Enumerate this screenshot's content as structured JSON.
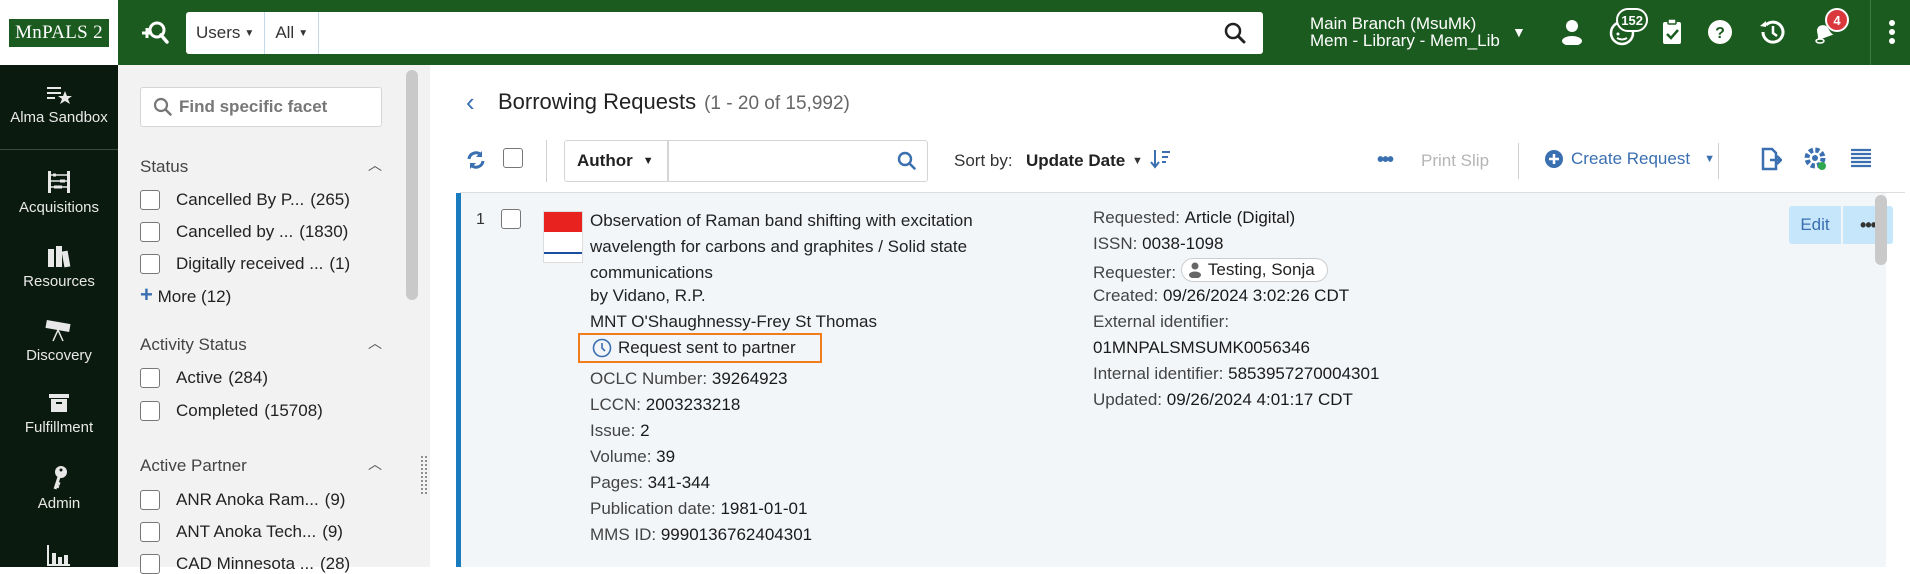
{
  "topbar": {
    "logo": "MnPALS 2",
    "search_scope": "Users",
    "search_field": "All",
    "search_value": "",
    "branch_line1": "Main Branch (MsuMk)",
    "branch_line2": "Mem - Library - Mem_Lib",
    "tasks_badge": "152",
    "notifications_badge": "4",
    "icons": [
      "advanced-search-icon",
      "user-icon",
      "tasks-icon",
      "clipboard-icon",
      "help-icon",
      "history-icon",
      "notifications-icon",
      "more-vertical-icon"
    ]
  },
  "leftnav": {
    "items": [
      {
        "label": "Alma Sandbox",
        "icon": "list-star-icon"
      },
      {
        "label": "Acquisitions",
        "icon": "abacus-icon"
      },
      {
        "label": "Resources",
        "icon": "books-icon"
      },
      {
        "label": "Discovery",
        "icon": "telescope-icon"
      },
      {
        "label": "Fulfillment",
        "icon": "box-icon"
      },
      {
        "label": "Admin",
        "icon": "key-icon"
      },
      {
        "label": "",
        "icon": "analytics-icon"
      }
    ]
  },
  "facets": {
    "search_placeholder": "Find specific facet",
    "groups": [
      {
        "title": "Status",
        "items": [
          {
            "label": "Cancelled By P...",
            "count": "(265)"
          },
          {
            "label": "Cancelled by ...",
            "count": "(1830)"
          },
          {
            "label": "Digitally received ...",
            "count": "(1)"
          }
        ],
        "more": "More (12)"
      },
      {
        "title": "Activity Status",
        "items": [
          {
            "label": "Active",
            "count": "(284)"
          },
          {
            "label": "Completed",
            "count": "(15708)"
          }
        ]
      },
      {
        "title": "Active Partner",
        "items": [
          {
            "label": "ANR Anoka Ram...",
            "count": "(9)"
          },
          {
            "label": "ANT Anoka Tech...",
            "count": "(9)"
          },
          {
            "label": "CAD Minnesota ...",
            "count": "(28)"
          }
        ]
      }
    ]
  },
  "main": {
    "title": "Borrowing Requests",
    "count": "(1 - 20 of 15,992)",
    "search_field": "Author",
    "search_value": "",
    "sort_label": "Sort by:",
    "sort_value": "Update Date",
    "print_slip": "Print Slip",
    "create_request": "Create Request"
  },
  "results": [
    {
      "index": "1",
      "title": "Observation of Raman band shifting with excitation wavelength for carbons and graphites / Solid state communications",
      "author": "by Vidano, R.P.",
      "partner": "MNT O'Shaughnessy-Frey St Thomas",
      "status": "Request sent to partner",
      "left_fields": [
        {
          "label": "OCLC Number:",
          "value": "39264923"
        },
        {
          "label": "LCCN:",
          "value": "2003233218"
        },
        {
          "label": "Issue:",
          "value": "2"
        },
        {
          "label": "Volume:",
          "value": "39"
        },
        {
          "label": "Pages:",
          "value": "341-344"
        },
        {
          "label": "Publication date:",
          "value": "1981-01-01"
        },
        {
          "label": "MMS ID:",
          "value": "9990136762404301"
        }
      ],
      "requested_label": "Requested:",
      "requested_value": "Article (Digital)",
      "issn_label": "ISSN:",
      "issn_value": "0038-1098",
      "requester_label": "Requester:",
      "requester_value": "Testing, Sonja",
      "created_label": "Created:",
      "created_value": "09/26/2024 3:02:26 CDT",
      "external_label": "External identifier:",
      "external_value": "01MNPALSMSUMK0056346",
      "internal_label": "Internal identifier:",
      "internal_value": "5853957270004301",
      "updated_label": "Updated:",
      "updated_value": "09/26/2024 4:01:17 CDT",
      "edit_label": "Edit",
      "more_label": "•••"
    }
  ],
  "colors": {
    "brand_green": "#1c5b20",
    "accent_blue": "#3a6fb0",
    "highlight_orange": "#f07c1a",
    "row_border_blue": "#1a7bbf",
    "badge_red": "#d9393d"
  }
}
